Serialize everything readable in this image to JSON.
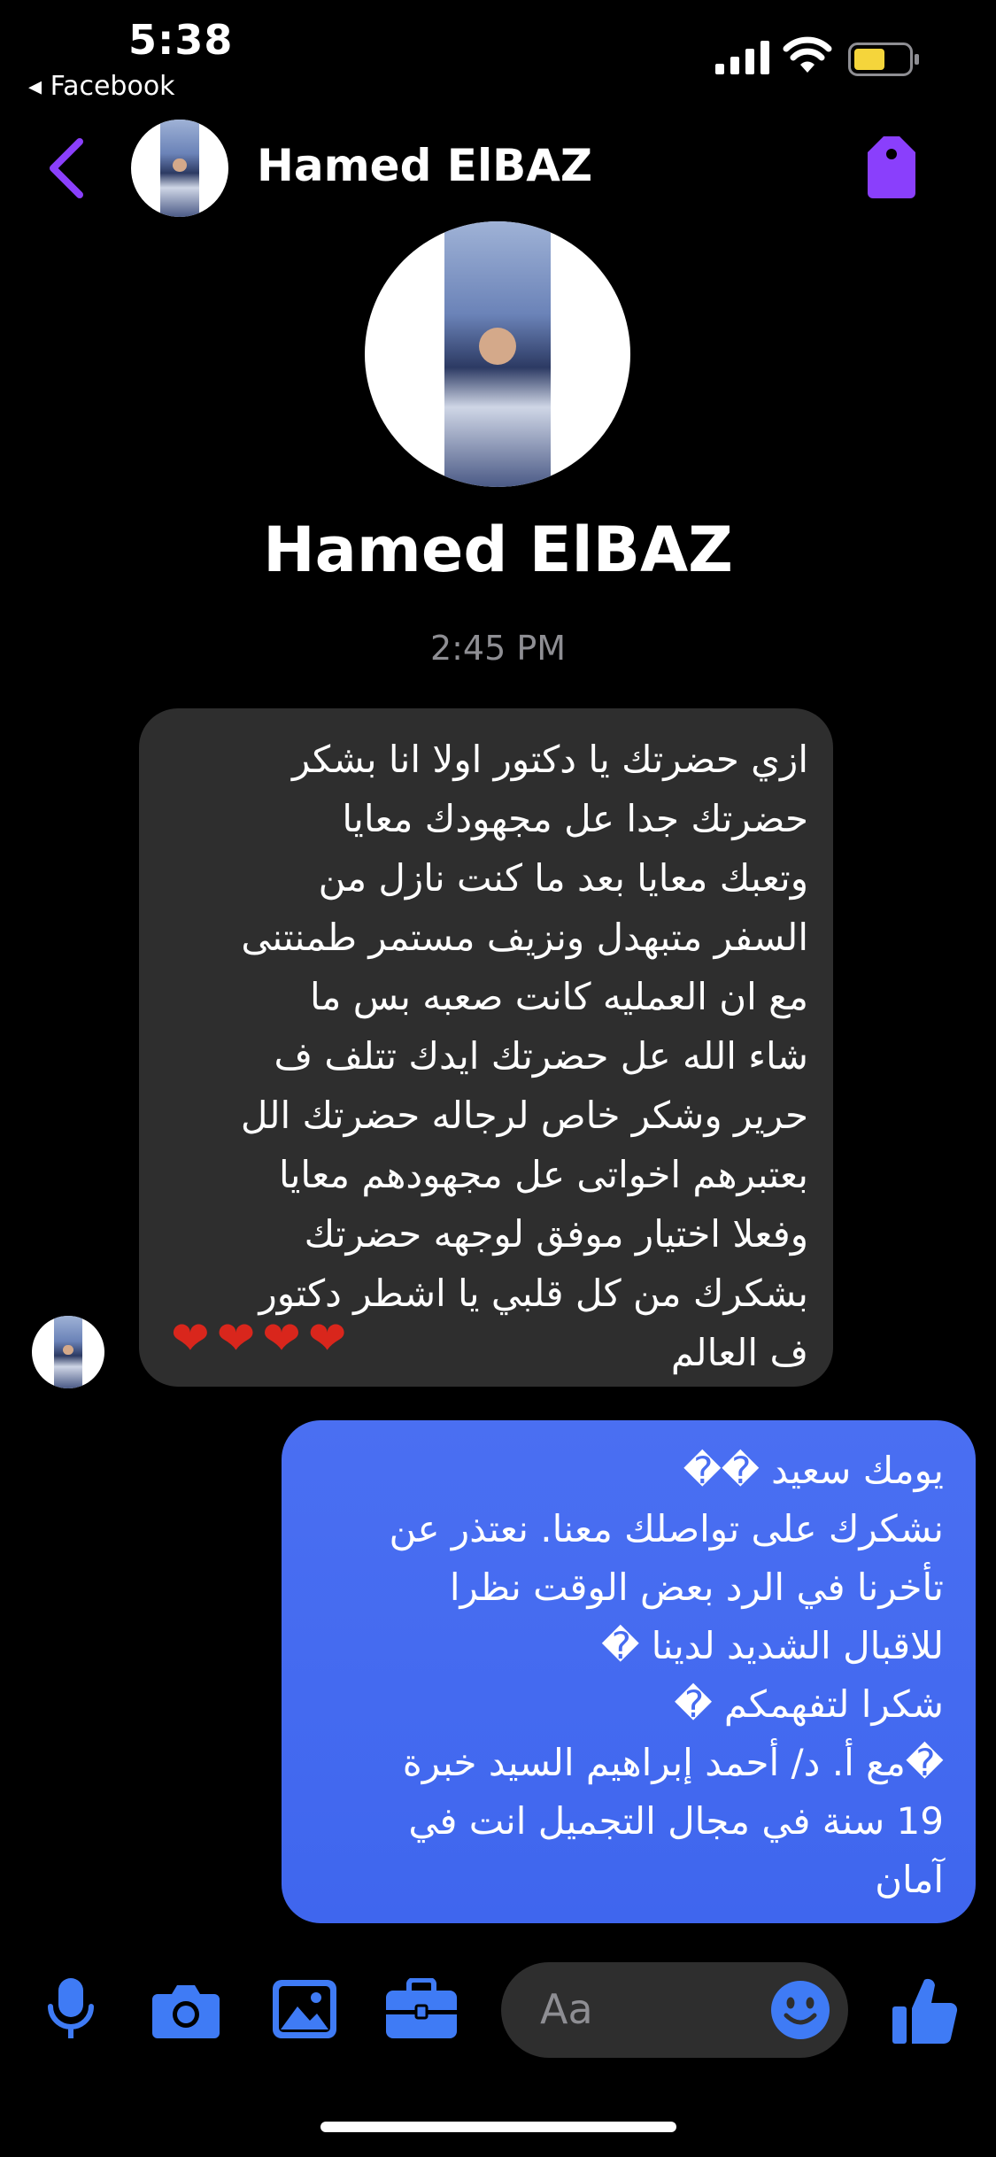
{
  "status_bar": {
    "time": "5:38",
    "back_app": "◂ Facebook"
  },
  "header": {
    "contact_name": "Hamed ElBAZ"
  },
  "profile": {
    "name": "Hamed ElBAZ"
  },
  "conversation": {
    "timestamp": "2:45 PM",
    "incoming": {
      "text": "ازي حضرتك يا دكتور اولا انا بشكر\nحضرتك جدا عل مجهودك معايا\nوتعبك معايا بعد ما كنت نازل من\nالسفر متبهدل ونزيف مستمر طمنتنى\nمع ان العمليه كانت صعبه بس ما\nشاء الله عل حضرتك ايدك تتلف ف\nحرير وشكر خاص لرجاله حضرتك الل\nبعتبرهم اخواتى عل مجهودهم معايا\nوفعلا اختيار موفق لوجهه حضرتك\nبشكرك من كل قلبي يا اشطر دكتور\nف العالم",
      "hearts": "❤❤❤❤"
    },
    "outgoing": {
      "text": "يومك سعيد ��\nنشكرك على تواصلك معنا. نعتذر عن\nتأخرنا في الرد بعض الوقت نظرا\nللاقبال الشديد لدينا �\nشكرا لتفهمكم �\n�مع أ. د/ أحمد إبراهيم السيد خبرة\n19 سنة في مجال التجميل انت في\nآمان"
    }
  },
  "composer": {
    "placeholder": "Aa"
  },
  "icons": {
    "back": "chevron-left-icon",
    "tag": "tag-icon",
    "mic": "microphone-icon",
    "camera": "camera-icon",
    "gallery": "gallery-icon",
    "briefcase": "briefcase-icon",
    "emoji": "smiley-icon",
    "like": "thumbs-up-icon"
  },
  "colors": {
    "accent": "#8a3ffc",
    "composer_icons": "#3f7bf5",
    "outgoing_bubble": "#4368f0",
    "incoming_bubble": "#2e2e2e",
    "heart": "#d9261c"
  }
}
